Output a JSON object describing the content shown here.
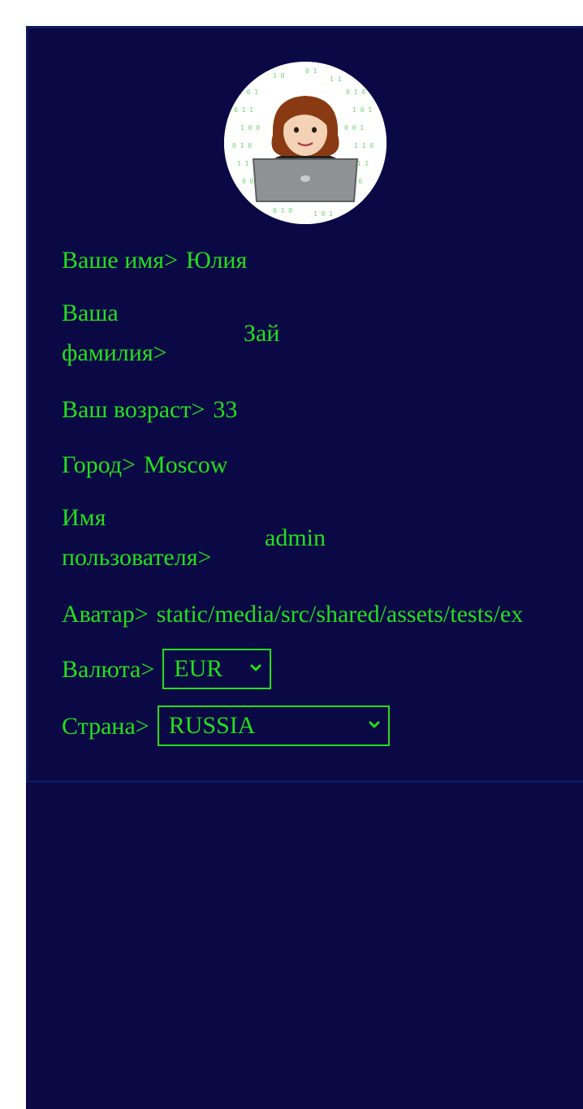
{
  "profile": {
    "name_label": "Ваше имя>",
    "name_value": "Юлия",
    "surname_label": "Ваша фамилия>",
    "surname_value": "Зай",
    "age_label": "Ваш возраст>",
    "age_value": "33",
    "city_label": "Город>",
    "city_value": "Moscow",
    "username_label": "Имя пользователя>",
    "username_value": "admin",
    "avatar_label": "Аватар>",
    "avatar_value": "static/media/src/shared/assets/tests/ex",
    "currency_label": "Валюта>",
    "currency_selected": "EUR",
    "country_label": "Страна>",
    "country_selected": "RUSSIA"
  },
  "avatar_image": {
    "icon": "user-avatar-woman-laptop-icon"
  },
  "colors": {
    "background": "#0b0846",
    "card_border": "#0c1a5e",
    "accent_text": "#22e01c",
    "page_margin": "#ffffff"
  }
}
